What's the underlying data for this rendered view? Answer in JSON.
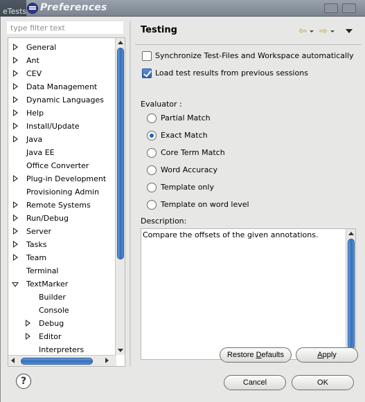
{
  "background": {
    "tab_text": "eTestsTe"
  },
  "titlebar": {
    "title": "Preferences"
  },
  "filter": {
    "placeholder": "type filter text"
  },
  "tree": {
    "items": [
      {
        "label": "General",
        "expander": "collapsed",
        "level": 0
      },
      {
        "label": "Ant",
        "expander": "collapsed",
        "level": 0
      },
      {
        "label": "CEV",
        "expander": "collapsed",
        "level": 0
      },
      {
        "label": "Data Management",
        "expander": "collapsed",
        "level": 0
      },
      {
        "label": "Dynamic Languages",
        "expander": "collapsed",
        "level": 0
      },
      {
        "label": "Help",
        "expander": "collapsed",
        "level": 0
      },
      {
        "label": "Install/Update",
        "expander": "collapsed",
        "level": 0
      },
      {
        "label": "Java",
        "expander": "collapsed",
        "level": 0
      },
      {
        "label": "Java EE",
        "expander": "none",
        "level": 0
      },
      {
        "label": "Office Converter",
        "expander": "none",
        "level": 0
      },
      {
        "label": "Plug-in Development",
        "expander": "collapsed",
        "level": 0
      },
      {
        "label": "Provisioning Admin",
        "expander": "none",
        "level": 0
      },
      {
        "label": "Remote Systems",
        "expander": "collapsed",
        "level": 0
      },
      {
        "label": "Run/Debug",
        "expander": "collapsed",
        "level": 0
      },
      {
        "label": "Server",
        "expander": "collapsed",
        "level": 0
      },
      {
        "label": "Tasks",
        "expander": "collapsed",
        "level": 0
      },
      {
        "label": "Team",
        "expander": "collapsed",
        "level": 0
      },
      {
        "label": "Terminal",
        "expander": "none",
        "level": 0
      },
      {
        "label": "TextMarker",
        "expander": "expanded",
        "level": 0
      },
      {
        "label": "Builder",
        "expander": "none",
        "level": 1
      },
      {
        "label": "Console",
        "expander": "none",
        "level": 1
      },
      {
        "label": "Debug",
        "expander": "collapsed",
        "level": 1
      },
      {
        "label": "Editor",
        "expander": "collapsed",
        "level": 1
      },
      {
        "label": "Interpreters",
        "expander": "none",
        "level": 1
      }
    ]
  },
  "page": {
    "title": "Testing",
    "sync_checkbox": {
      "label": "Synchronize Test-Files and Workspace automatically",
      "checked": false
    },
    "load_checkbox": {
      "label": "Load test results from previous sessions",
      "checked": true
    },
    "evaluator_label": "Evaluator :",
    "evaluators": [
      {
        "label": "Partial Match",
        "selected": false
      },
      {
        "label": "Exact Match",
        "selected": true
      },
      {
        "label": "Core Term Match",
        "selected": false
      },
      {
        "label": "Word Accuracy",
        "selected": false
      },
      {
        "label": "Template only",
        "selected": false
      },
      {
        "label": "Template on word level",
        "selected": false
      }
    ],
    "description_label": "Description:",
    "description_text": "Compare the offsets of the given annotations.",
    "restore_defaults": {
      "before": "Restore ",
      "mnemonic": "D",
      "after": "efaults"
    },
    "apply": {
      "before": "",
      "mnemonic": "A",
      "after": "pply"
    }
  },
  "footer": {
    "help": "?",
    "cancel": "Cancel",
    "ok": "OK"
  },
  "colors": {
    "accent": "#2f6fbf",
    "nav_arrow": "#c4a44a"
  }
}
